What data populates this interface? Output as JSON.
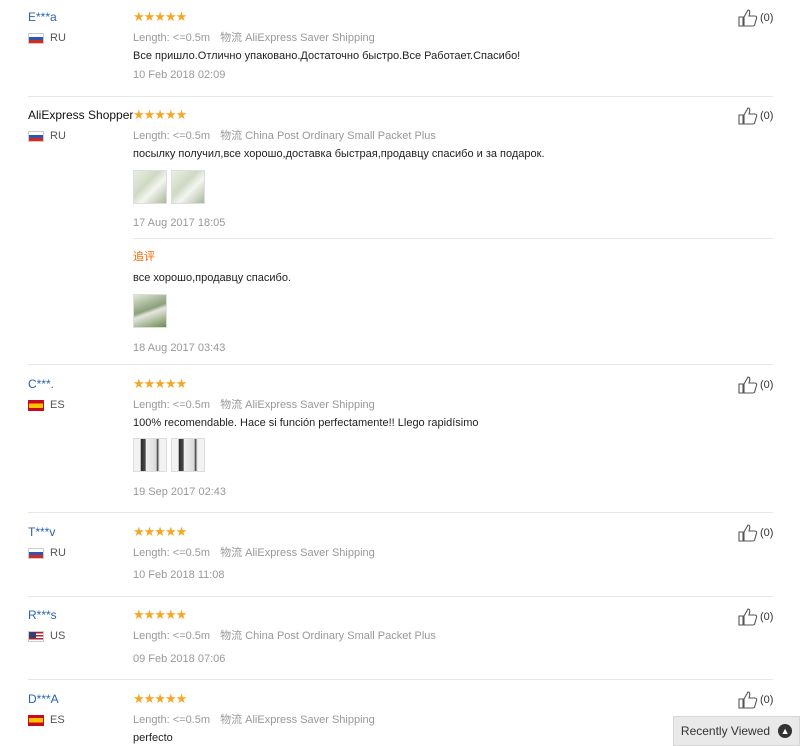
{
  "labels": {
    "length_key": "Length:",
    "shipping_key": "物流",
    "helpful_count": "(0)",
    "follow_label": "追评"
  },
  "reviews": [
    {
      "user": "E***a",
      "country": "RU",
      "length": "<=0.5m",
      "shipping": "AliExpress Saver Shipping",
      "text": "Все пришло.Отлично упаковано.Достаточно быстро.Все Работает.Спасибо!",
      "date": "10 Feb 2018 02:09"
    },
    {
      "user": "AliExpress Shopper",
      "country": "RU",
      "length": "<=0.5m",
      "shipping": "China Post Ordinary Small Packet Plus",
      "text": "посылку получил,все хорошо,доставка быстрая,продавцу спасибо и за подарок.",
      "date": "17 Aug 2017 18:05",
      "followup_text": "все хорошо,продавцу спасибо.",
      "followup_date": "18 Aug 2017 03:43"
    },
    {
      "user": "C***.",
      "country": "ES",
      "length": "<=0.5m",
      "shipping": "AliExpress Saver Shipping",
      "text": "100% recomendable. Hace si función perfectamente!! Llego rapidísimo",
      "date": "19 Sep 2017 02:43"
    },
    {
      "user": "T***v",
      "country": "RU",
      "length": "<=0.5m",
      "shipping": "AliExpress Saver Shipping",
      "date": "10 Feb 2018 11:08"
    },
    {
      "user": "R***s",
      "country": "US",
      "length": "<=0.5m",
      "shipping": "China Post Ordinary Small Packet Plus",
      "date": "09 Feb 2018 07:06"
    },
    {
      "user": "D***A",
      "country": "ES",
      "length": "<=0.5m",
      "shipping": "AliExpress Saver Shipping",
      "text": "perfecto"
    }
  ],
  "stars": "★★★★★",
  "recently_viewed": "Recently Viewed",
  "colors": {
    "star": "#f5a623",
    "username": "#2a63b1",
    "followup": "#ff6600"
  },
  "icons": {
    "helpful": "thumbs-up-icon",
    "scroll": "chevron-up-icon"
  }
}
